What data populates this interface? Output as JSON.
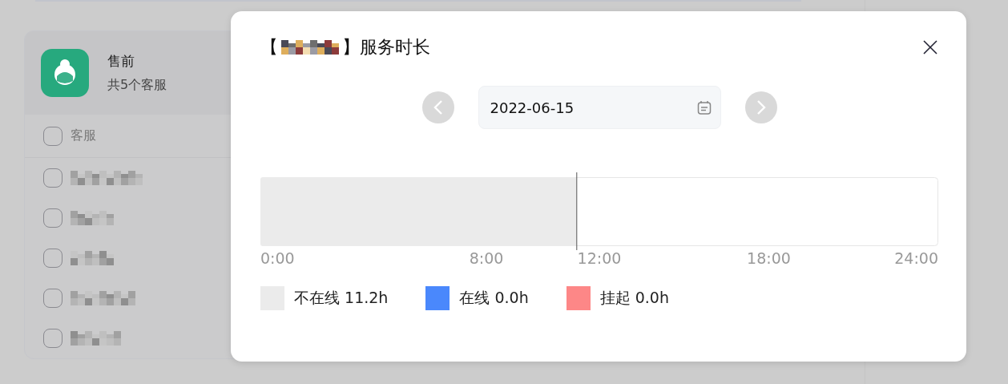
{
  "group": {
    "name": "售前",
    "count": "共5个客服",
    "header_label": "客服",
    "header_checked": false,
    "agents": [
      {
        "checked": false
      },
      {
        "checked": false
      },
      {
        "checked": false
      },
      {
        "checked": false
      },
      {
        "checked": false
      }
    ]
  },
  "dialog": {
    "title_open": "【",
    "title_rest": "】服务时长",
    "date": "2022-06-15",
    "chart_data": {
      "type": "bar",
      "orientation": "horizontal",
      "stacked": true,
      "xlim": [
        0,
        24
      ],
      "xticks": [
        {
          "value": 0,
          "label": "0:00"
        },
        {
          "value": 8,
          "label": "8:00"
        },
        {
          "value": 12,
          "label": "12:00"
        },
        {
          "value": 18,
          "label": "18:00"
        },
        {
          "value": 24,
          "label": "24:00"
        }
      ],
      "series": [
        {
          "name": "不在线",
          "color": "#ebebeb",
          "values": [
            11.2
          ]
        },
        {
          "name": "在线",
          "color": "#4a88fc",
          "values": [
            0
          ]
        },
        {
          "name": "挂起",
          "color": "#fd8787",
          "values": [
            0
          ]
        }
      ],
      "ref_lines": [
        {
          "axis": "x",
          "value": 11.2
        }
      ]
    },
    "legend_totals": [
      "11.2h",
      "0.0h",
      "0.0h"
    ]
  }
}
